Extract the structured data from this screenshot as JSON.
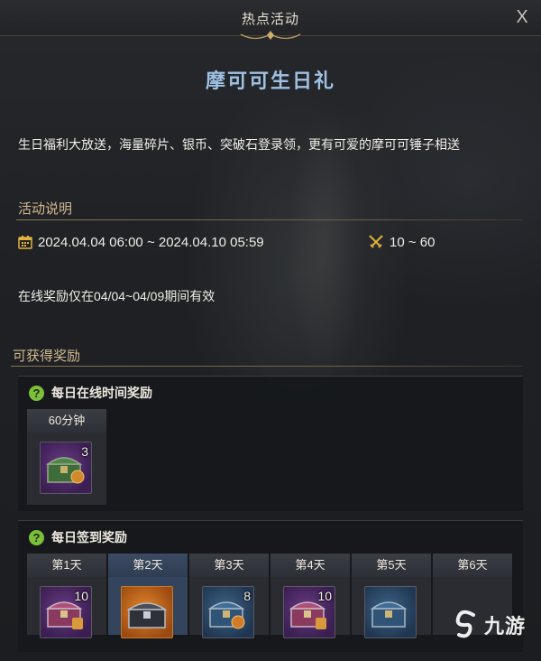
{
  "window": {
    "title": "热点活动",
    "close_label": "X"
  },
  "event": {
    "title": "摩可可生日礼",
    "description": "生日福利大放送，海量碎片、银币、突破石登录领，更有可爱的摩可可锤子相送"
  },
  "details": {
    "section_title": "活动说明",
    "period": "2024.04.04 06:00 ~ 2024.04.10 05:59",
    "level_range": "10 ~ 60",
    "note": "在线奖励仅在04/04~04/09期间有效"
  },
  "rewards": {
    "section_title": "可获得奖励",
    "online": {
      "label": "每日在线时间奖励",
      "help_icon": "?",
      "tier": {
        "time": "60分钟",
        "count": "3",
        "icon": "green-chest-icon"
      }
    },
    "checkin": {
      "label": "每日签到奖励",
      "help_icon": "?",
      "days": [
        {
          "day": "第1天",
          "count": "10",
          "icon": "pink-chest-icon",
          "frame": "purple"
        },
        {
          "day": "第2天",
          "count": "",
          "icon": "silver-chest-icon",
          "frame": "orange"
        },
        {
          "day": "第3天",
          "count": "8",
          "icon": "blue-chest-icon",
          "frame": "blue"
        },
        {
          "day": "第4天",
          "count": "10",
          "icon": "pink-chest-icon",
          "frame": "purple"
        },
        {
          "day": "第5天",
          "count": "",
          "icon": "blue-chest-icon",
          "frame": "blue"
        },
        {
          "day": "第6天",
          "count": "",
          "icon": "chest-icon",
          "frame": "blue"
        }
      ]
    }
  },
  "watermark": {
    "text": "九游"
  },
  "colors": {
    "title_blue": "#9fc1e3",
    "section_gold": "#d2b98f",
    "help_green": "#7bbf3a"
  }
}
